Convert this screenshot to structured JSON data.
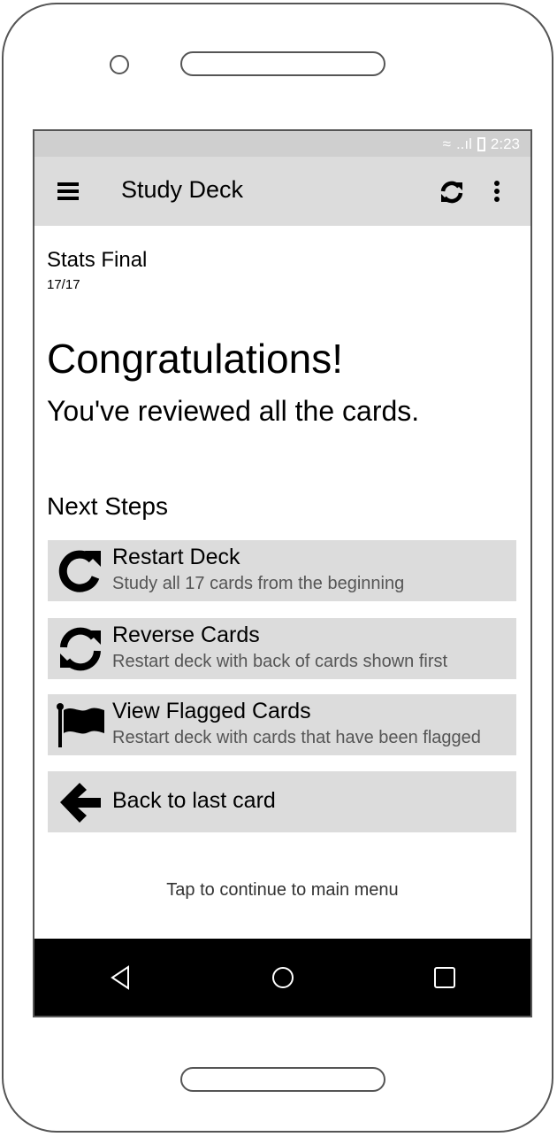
{
  "status_bar": {
    "time": "2:23",
    "signal": "..ıl"
  },
  "app_bar": {
    "title": "Study Deck",
    "icons": [
      "menu-icon",
      "refresh-icon",
      "more-vert-icon"
    ]
  },
  "deck": {
    "name": "Stats Final",
    "progress": "17/17"
  },
  "congrats": {
    "headline": "Congratulations!",
    "subtitle": "You've reviewed all the cards."
  },
  "next_steps": {
    "heading": "Next Steps",
    "items": [
      {
        "icon": "restart-icon",
        "title": "Restart Deck",
        "subtitle": "Study all 17 cards from the beginning"
      },
      {
        "icon": "reverse-icon",
        "title": "Reverse Cards",
        "subtitle": "Restart deck with back of cards shown first"
      },
      {
        "icon": "flag-icon",
        "title": "View Flagged Cards",
        "subtitle": "Restart deck with cards that have been flagged"
      },
      {
        "icon": "arrow-left-icon",
        "title": "Back to last card",
        "subtitle": ""
      }
    ]
  },
  "footer_hint": "Tap to continue to main menu",
  "colors": {
    "app_bar": "#dcdcdc",
    "status_bar": "#cfcfcf",
    "step_bg": "#dcdcdc",
    "nav_bar": "#000000"
  }
}
